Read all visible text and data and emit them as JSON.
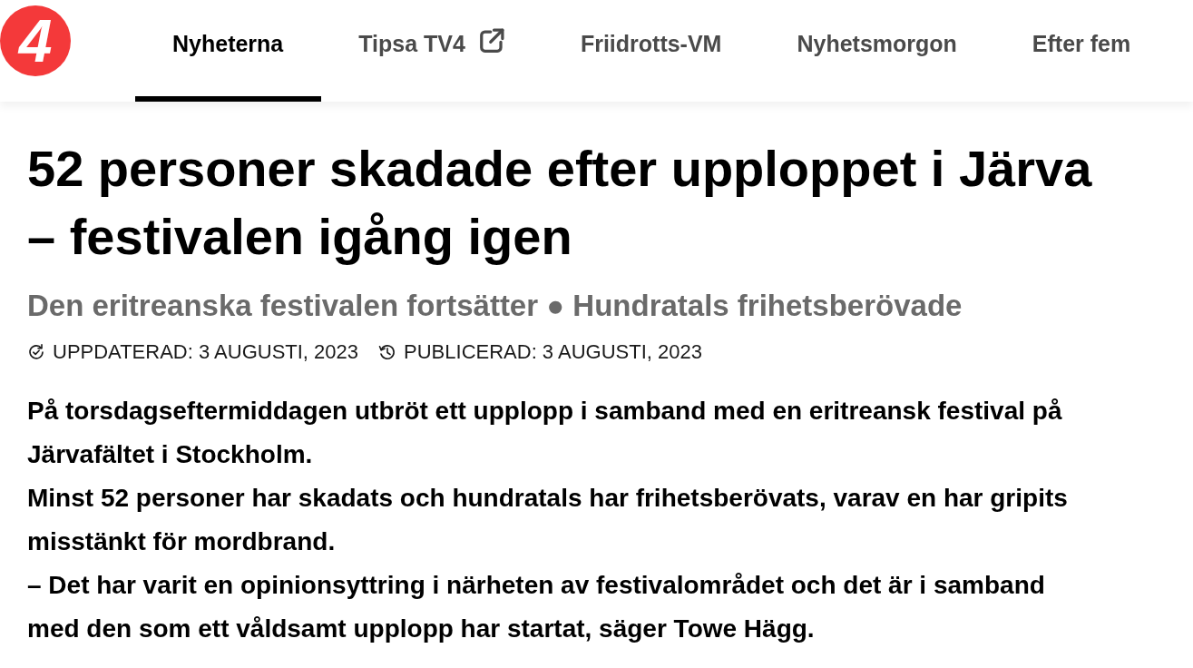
{
  "logo": {
    "text": "4"
  },
  "nav": {
    "tabs": [
      {
        "label": "Nyheterna",
        "selected": true,
        "external": false
      },
      {
        "label": "Tipsa TV4",
        "selected": false,
        "external": true
      },
      {
        "label": "Friidrotts-VM",
        "selected": false,
        "external": false
      },
      {
        "label": "Nyhetsmorgon",
        "selected": false,
        "external": false
      },
      {
        "label": "Efter fem",
        "selected": false,
        "external": false
      }
    ]
  },
  "article": {
    "headline": "52 personer skadade efter upploppet i Järva – festivalen igång igen",
    "subheadline": "Den eritreanska festivalen fortsätter ● Hundratals frihetsberövade",
    "meta": [
      {
        "kind": "updated",
        "text": "UPPDATERAD: 3 AUGUSTI, 2023"
      },
      {
        "kind": "published",
        "text": "PUBLICERAD: 3 AUGUSTI, 2023"
      }
    ],
    "paragraphs": [
      "På torsdagseftermiddagen utbröt ett upplopp i samband med en eritreansk festival på Järvafältet i Stockholm.",
      "Minst 52 personer har skadats och hundratals har frihetsberövats, varav en har gripits misstänkt för mordbrand.",
      "– Det har varit en opinionsyttring i närheten av festivalområdet och det är i samband med den som ett våldsamt upplopp har startat, säger Towe Hägg."
    ]
  }
}
